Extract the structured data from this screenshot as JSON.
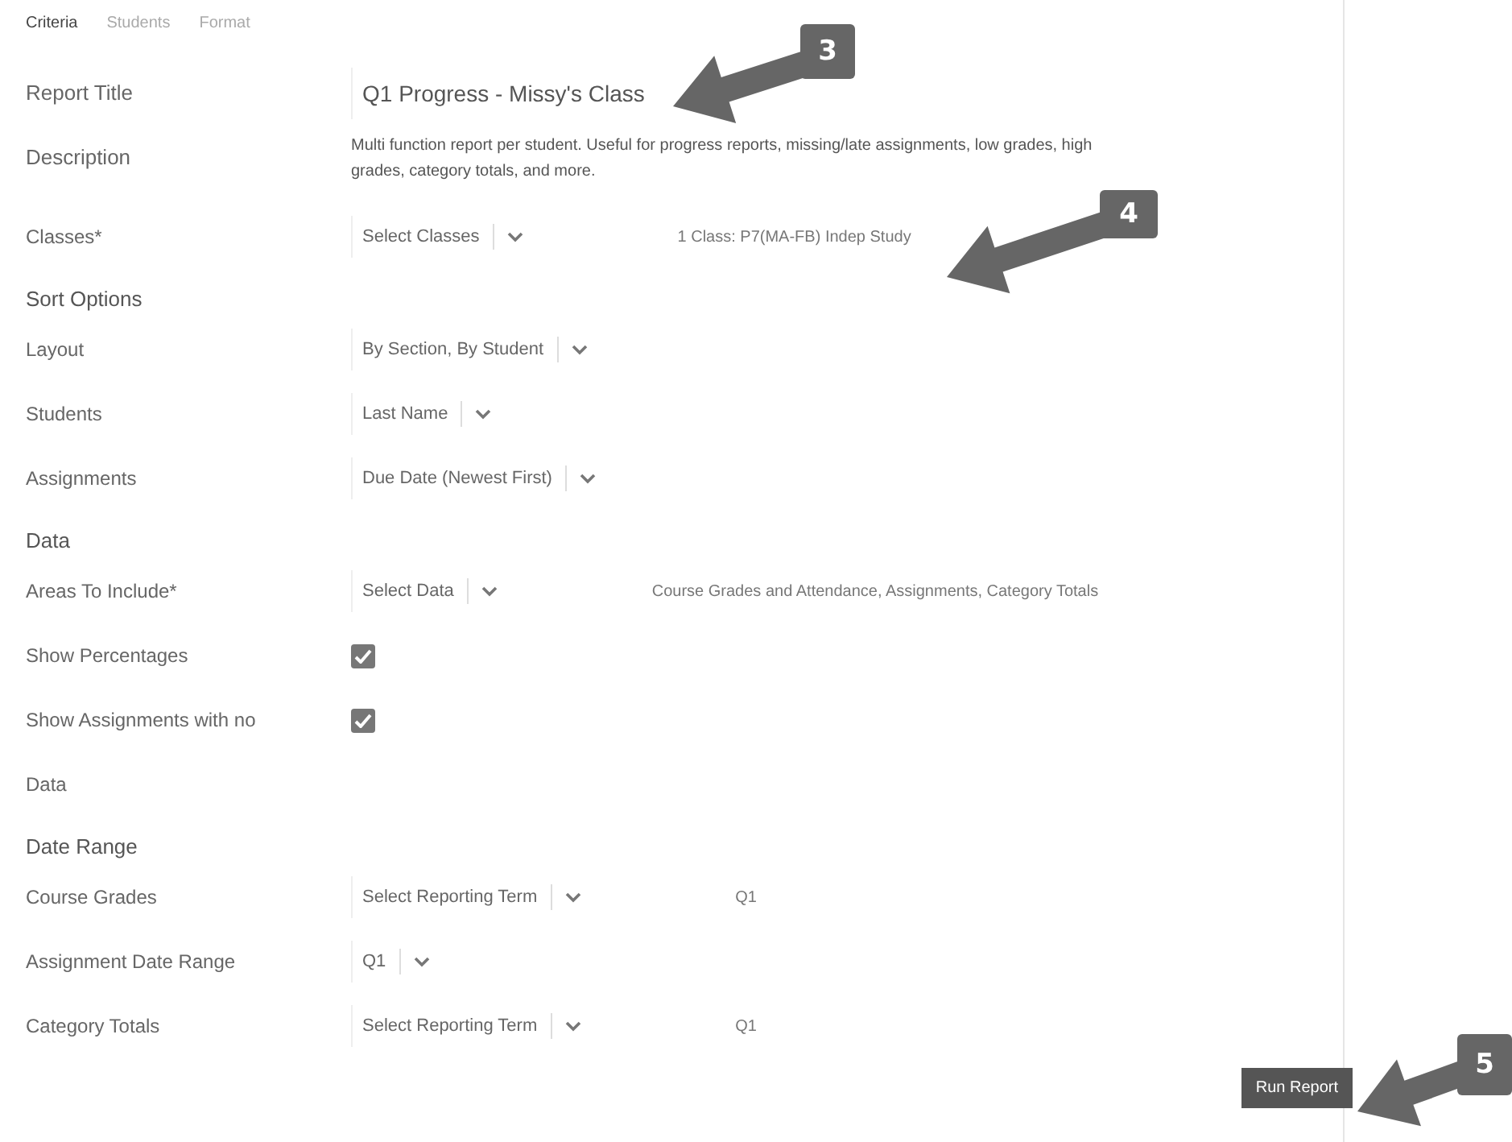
{
  "tabs": [
    {
      "label": "Criteria",
      "selected": true
    },
    {
      "label": "Students",
      "selected": false
    },
    {
      "label": "Format",
      "selected": false
    }
  ],
  "rows": [
    {
      "kind": "text",
      "label": "Report Title",
      "value": "Q1 Progress - Missy's Class"
    },
    {
      "kind": "description",
      "label": "Description",
      "value": "Multi function report per student. Useful for progress reports, missing/late assignments, low grades, high grades, category totals, and more."
    },
    {
      "kind": "select",
      "label": "Classes*",
      "value": "Select Classes",
      "summary": "1 Class: P7(MA-FB) Indep Study"
    },
    {
      "kind": "heading",
      "label": "Sort Options"
    },
    {
      "kind": "select",
      "label": "Layout",
      "value": "By Section, By Student"
    },
    {
      "kind": "select",
      "label": "Students",
      "value": "Last Name"
    },
    {
      "kind": "select",
      "label": "Assignments",
      "value": "Due Date (Newest First)"
    },
    {
      "kind": "heading",
      "label": "Data"
    },
    {
      "kind": "select",
      "label": "Areas To Include*",
      "value": "Select Data",
      "summary": "Course Grades and Attendance, Assignments, Category Totals"
    },
    {
      "kind": "checkbox",
      "label": "Show Percentages",
      "checked": true
    },
    {
      "kind": "checkbox",
      "label": "Show Assignments with no Data",
      "checked": true
    },
    {
      "kind": "heading",
      "label": "Date Range"
    },
    {
      "kind": "select",
      "label": "Course Grades",
      "value": "Select Reporting Term",
      "summary": "Q1"
    },
    {
      "kind": "select",
      "label": "Assignment Date Range",
      "value": "Q1"
    },
    {
      "kind": "select",
      "label": "Category Totals",
      "value": "Select Reporting Term",
      "summary": "Q1"
    }
  ],
  "run_button": "Run Report",
  "callouts": [
    {
      "number": "3"
    },
    {
      "number": "4"
    },
    {
      "number": "5"
    }
  ]
}
